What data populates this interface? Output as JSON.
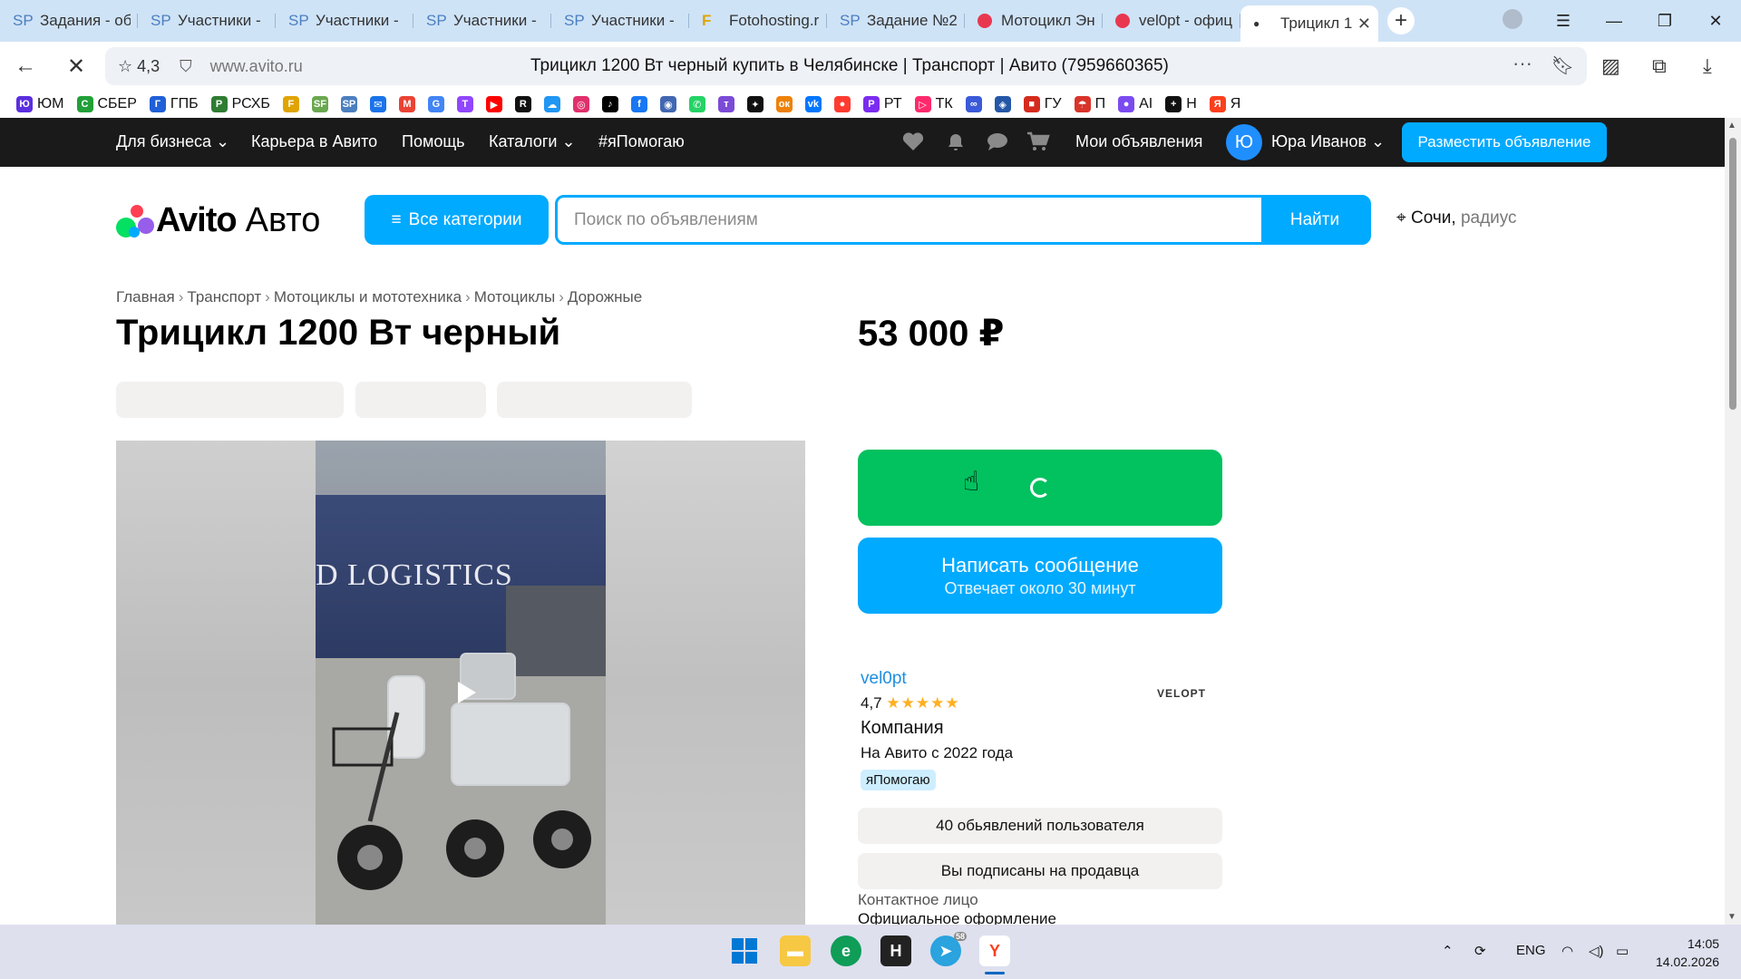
{
  "browser": {
    "tabs": [
      {
        "icon": "SP",
        "label": "Задания - об"
      },
      {
        "icon": "SP",
        "label": "Участники - "
      },
      {
        "icon": "SP",
        "label": "Участники - "
      },
      {
        "icon": "SP",
        "label": "Участники - "
      },
      {
        "icon": "SP",
        "label": "Участники - "
      },
      {
        "icon": "F",
        "label": "Fotohosting.r"
      },
      {
        "icon": "SP",
        "label": "Задание №2"
      },
      {
        "icon": "",
        "label": "Мотоцикл Эн"
      },
      {
        "icon": "",
        "label": "vel0pt - офиц"
      },
      {
        "icon": "",
        "label": "Трицикл 1"
      }
    ],
    "rating": "4,3",
    "domain": "www.avito.ru",
    "page_title": "Трицикл 1200 Вт черный купить в Челябинске | Транспорт | Авито (7959660365)",
    "bookmarks": [
      {
        "label": "ЮМ",
        "color": "#5b2ee0",
        "icon": "Ю"
      },
      {
        "label": "СБЕР",
        "color": "#21a038",
        "icon": "С"
      },
      {
        "label": "ГПБ",
        "color": "#1f5fd8",
        "icon": "Г"
      },
      {
        "label": "РСХБ",
        "color": "#2e7d32",
        "icon": "Р"
      },
      {
        "label": "",
        "color": "#e0a400",
        "icon": "F"
      },
      {
        "label": "",
        "color": "#6aa84f",
        "icon": "SF"
      },
      {
        "label": "",
        "color": "#4b7fc0",
        "icon": "SP"
      },
      {
        "label": "",
        "color": "#1a73e8",
        "icon": "✉"
      },
      {
        "label": "",
        "color": "#ea4335",
        "icon": "M"
      },
      {
        "label": "",
        "color": "#4285f4",
        "icon": "G"
      },
      {
        "label": "",
        "color": "#9146ff",
        "icon": "T"
      },
      {
        "label": "",
        "color": "#ff0000",
        "icon": "▶"
      },
      {
        "label": "",
        "color": "#111111",
        "icon": "R"
      },
      {
        "label": "",
        "color": "#2196f3",
        "icon": "☁"
      },
      {
        "label": "",
        "color": "#e1306c",
        "icon": "◎"
      },
      {
        "label": "",
        "color": "#000000",
        "icon": "♪"
      },
      {
        "label": "",
        "color": "#1877f2",
        "icon": "f"
      },
      {
        "label": "",
        "color": "#4267b2",
        "icon": "◉"
      },
      {
        "label": "",
        "color": "#25d366",
        "icon": "✆"
      },
      {
        "label": "",
        "color": "#7b4bd6",
        "icon": "т"
      },
      {
        "label": "",
        "color": "#111111",
        "icon": "✦"
      },
      {
        "label": "",
        "color": "#ee8208",
        "icon": "ок"
      },
      {
        "label": "",
        "color": "#0077ff",
        "icon": "vk"
      },
      {
        "label": "",
        "color": "#ff3b30",
        "icon": "●"
      },
      {
        "label": "РТ",
        "color": "#7b2cf0",
        "icon": "P"
      },
      {
        "label": "ТК",
        "color": "#ff2a6d",
        "icon": "▷"
      },
      {
        "label": "",
        "color": "#3a5ad9",
        "icon": "∞"
      },
      {
        "label": "",
        "color": "#2457a8",
        "icon": "◈"
      },
      {
        "label": "ГУ",
        "color": "#d52b1e",
        "icon": "■"
      },
      {
        "label": "П",
        "color": "#d8342a",
        "icon": "☂"
      },
      {
        "label": "AI",
        "color": "#7b4bf0",
        "icon": "●"
      },
      {
        "label": "Н",
        "color": "#111111",
        "icon": "+"
      },
      {
        "label": "Я",
        "color": "#fc3f1d",
        "icon": "Я"
      }
    ]
  },
  "topnav": {
    "business": "Для бизнеса",
    "career": "Карьера в Авито",
    "help": "Помощь",
    "catalogs": "Каталоги",
    "ihelp": "#яПомогаю",
    "my_ads": "Мои объявления",
    "avatar_letter": "Ю",
    "user": "Юра Иванов",
    "post_ad": "Разместить объявление"
  },
  "header": {
    "logo_word": "Avito",
    "logo_sub": "Авто",
    "all_categories": "Все категории",
    "search_placeholder": "Поиск по объявлениям",
    "search_button": "Найти",
    "city": "Сочи,",
    "radius": "радиус"
  },
  "breadcrumbs": [
    "Главная",
    "Транспорт",
    "Мотоциклы и мототехника",
    "Мотоциклы",
    "Дорожные"
  ],
  "listing": {
    "title": "Трицикл 1200 Вт черный",
    "price": "53 000 ₽",
    "photo_text": "D LOGISTICS"
  },
  "actions": {
    "message_label": "Написать сообщение",
    "message_sub": "Отвечает около 30 минут"
  },
  "seller": {
    "name": "vel0pt",
    "rating": "4,7",
    "stars": "★★★★★",
    "type": "Компания",
    "since": "На Авито с 2022 года",
    "badge": "яПомогаю",
    "logo_text": "VELOPT",
    "ads_count": "40 обьявлений пользователя",
    "subscribed": "Вы подписаны на продавца",
    "contact_label": "Контактное лицо",
    "contact_value": "Официальное оформление"
  },
  "taskbar": {
    "lang": "ENG",
    "time": "14:05",
    "date": "14.02.2026",
    "telegram_badge": "58"
  },
  "colors": {
    "avito_blue": "#00aaff",
    "call_green": "#02c15f",
    "nav_dark": "#1a1a1a",
    "link_blue": "#1d8fe0"
  }
}
